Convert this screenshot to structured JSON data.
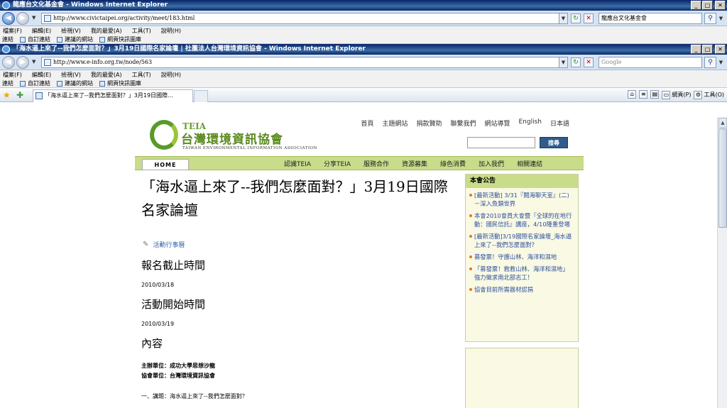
{
  "window1": {
    "title": "龍應台文化基金會 - Windows Internet Explorer",
    "url": "http://www.civictaipei.org/activity/meet/183.html",
    "search_value": "龍應台文化基金會"
  },
  "window2": {
    "title": "「海水逼上來了--我們怎麼面對？」3月19日國際名家論壇 | 社團法人台灣環境資訊協會 - Windows Internet Explorer",
    "url": "http://www.e-info.org.tw/node/563",
    "search_placeholder": "Google",
    "tab_title": "「海水逼上來了--我們怎麼面對？」3月19日國際..."
  },
  "menu": [
    "檔案(F)",
    "編輯(E)",
    "檢視(V)",
    "我的最愛(A)",
    "工具(T)",
    "說明(H)"
  ],
  "favorites": {
    "label": "連結",
    "items": [
      "自訂連結",
      "建議的網站",
      "網頁快訊圖庫"
    ]
  },
  "commandbar": {
    "page": "網頁(P)",
    "tools": "工具(O)"
  },
  "site": {
    "logo_teia": "TEIA",
    "logo_cn": "台灣環境資訊協會",
    "logo_en": "TAIWAN ENVIRONMENTAL INFORMATION ASSOCIATION",
    "top_links": [
      "首頁",
      "主題網站",
      "捐款贊助",
      "聯繫我們",
      "網站導覽",
      "English",
      "日本語"
    ],
    "search_button": "搜尋",
    "home_button": "HOME",
    "nav_links": [
      "認識TEIA",
      "分享TEIA",
      "服務合作",
      "資源募集",
      "綠色消費",
      "加入我們",
      "相關連結"
    ]
  },
  "article": {
    "title": "「海水逼上來了--我們怎麼面對？」3月19日國際名家論壇",
    "category": "活動行事曆",
    "deadline_heading": "報名截止時間",
    "deadline_date": "2010/03/18",
    "start_heading": "活動開始時間",
    "start_date": "2010/03/19",
    "content_heading": "內容",
    "organizer": "主辦單位：成功大學思想沙龍",
    "co_organizer": "協會單位：台灣環境資訊協會",
    "topic": "一、講題：海水逼上來了--我們怎麼面對？"
  },
  "sidebar": {
    "heading": "本會公告",
    "items": [
      "[最新活動] 3/31『閱海聊天室』(二)－深入魚類世界",
      "本會2010會員大會暨『全球的在地行動：國民信託』講座，4/10隆重登場",
      "[最新活動]3/19國際名家論壇_海水逼上來了--我們怎麼面對？",
      "募發票！守護山林、海洋和濕地",
      "「募發票！救救山林、海洋和濕地」強力徵求南北部志工！",
      "協會目前所需器材認捐"
    ]
  }
}
